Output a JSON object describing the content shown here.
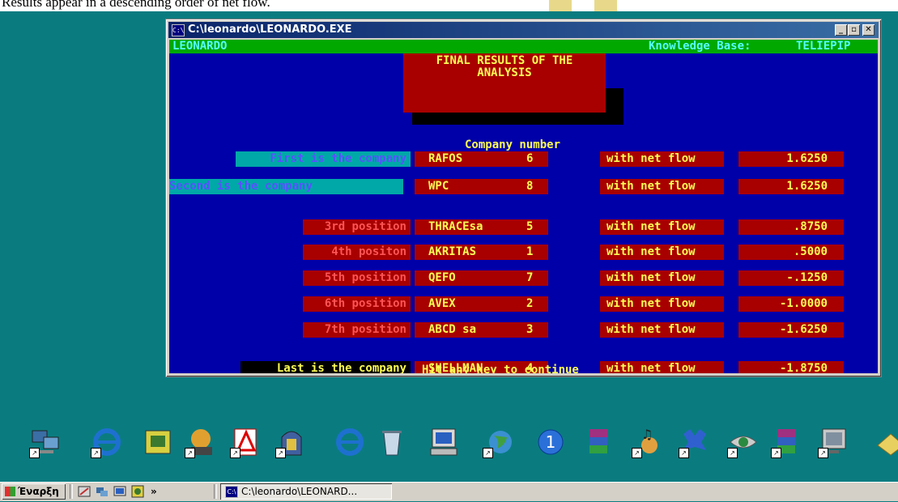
{
  "caption": "Results appear in a descending order of net flow.",
  "window": {
    "title": "C:\\leonardo\\LEONARDO.EXE",
    "icon_text": "C:\\"
  },
  "console": {
    "app_name": "LEONARDO",
    "kb_label": "Knowledge Base:",
    "kb_value": "TELIEPIP",
    "banner_line1": "FINAL RESULTS OF THE",
    "banner_line2": "ANALYSIS",
    "company_number_header": "Company number",
    "rows": [
      {
        "label": "First is the company",
        "company": "RAFOS",
        "number": "6",
        "flow_label": "with net flow",
        "flow": "1.6250"
      },
      {
        "label": "Second is the company",
        "company": "WPC",
        "number": "8",
        "flow_label": "with net flow",
        "flow": "1.6250"
      },
      {
        "label": "3rd position",
        "company": "THRACEsa",
        "number": "5",
        "flow_label": "with net flow",
        "flow": ".8750"
      },
      {
        "label": "4th positon",
        "company": "AKRITAS",
        "number": "1",
        "flow_label": "with net flow",
        "flow": ".5000"
      },
      {
        "label": "5th position",
        "company": "QEFO",
        "number": "7",
        "flow_label": "with net flow",
        "flow": "-.1250"
      },
      {
        "label": "6th position",
        "company": "AVEX",
        "number": "2",
        "flow_label": "with net flow",
        "flow": "-1.0000"
      },
      {
        "label": "7th position",
        "company": "ABCD sa",
        "number": "3",
        "flow_label": "with net flow",
        "flow": "-1.6250"
      },
      {
        "label": "Last is the company",
        "company": "SHELLMAN",
        "number": "4",
        "flow_label": "with net flow",
        "flow": "-1.8750"
      }
    ],
    "footer": "Hit any key to continue"
  },
  "desktop_icons": [
    "network-icon",
    "internet-explorer-icon",
    "control-panel-icon",
    "media-player-icon",
    "acrobat-icon",
    "jukebox-icon",
    "internet-explorer-2-icon",
    "recycle-bin-icon",
    "my-computer-icon",
    "globe-icon",
    "info-icon",
    "winrar-icon",
    "music-icon",
    "driver-icon",
    "eye-icon",
    "archive-icon",
    "display-icon",
    "folder-icon"
  ],
  "taskbar": {
    "start_label": "Έναρξη",
    "chevron": "»",
    "task_label": "C:\\leonardo\\LEONARD..."
  }
}
